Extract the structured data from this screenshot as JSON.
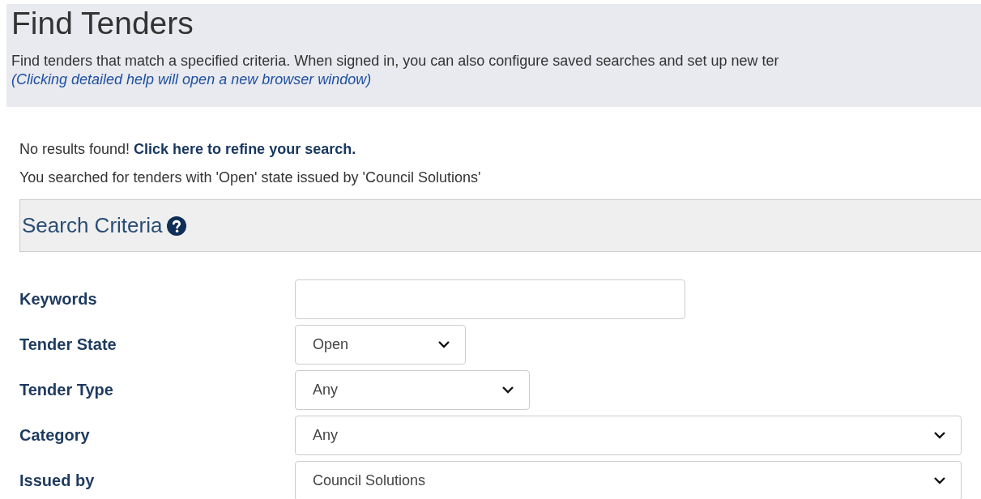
{
  "header": {
    "title": "Find Tenders",
    "description": "Find tenders that match a specified criteria.  When signed in, you can also configure saved searches and set up new ter",
    "help_note": "(Clicking detailed help will open a new browser window)"
  },
  "results": {
    "message": "No results found!",
    "link": "Click here to refine your search.",
    "summary": "You searched for tenders with 'Open' state issued by 'Council Solutions'"
  },
  "search_criteria": {
    "title": "Search Criteria",
    "fields": [
      {
        "label": "Keywords",
        "kind": "text"
      },
      {
        "label": "Tender State",
        "kind": "select",
        "value": "Open"
      },
      {
        "label": "Tender Type",
        "kind": "select",
        "value": "Any"
      },
      {
        "label": "Category",
        "kind": "select",
        "value": "Any"
      },
      {
        "label": "Issued by",
        "kind": "select",
        "value": "Council Solutions"
      }
    ]
  }
}
